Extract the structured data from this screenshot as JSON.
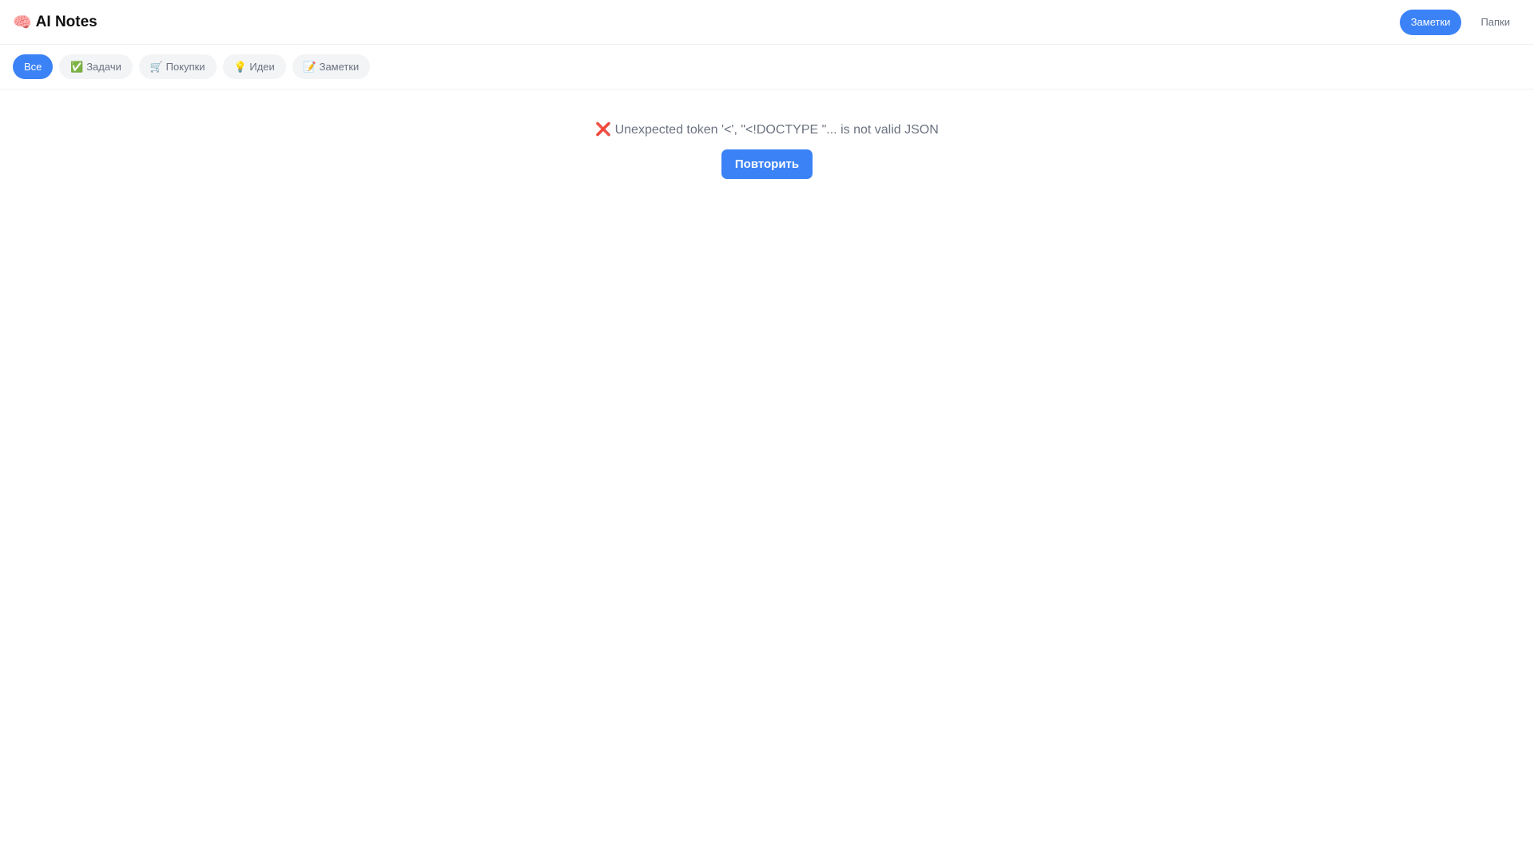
{
  "header": {
    "logo_icon": "🧠",
    "title": "AI Notes",
    "nav": [
      {
        "label": "Заметки",
        "active": true
      },
      {
        "label": "Папки",
        "active": false
      }
    ]
  },
  "filters": [
    {
      "label": "Все",
      "active": true
    },
    {
      "label": "✅ Задачи"
    },
    {
      "label": "🛒 Покупки"
    },
    {
      "label": "💡 Идеи"
    },
    {
      "label": "📝 Заметки"
    }
  ],
  "main": {
    "error": "❌ Unexpected token '<', \"<!DOCTYPE \"... is not valid JSON",
    "retry_label": "Повторить"
  },
  "colors": {
    "accent": "#3b82f6",
    "muted": "#6b7280"
  }
}
